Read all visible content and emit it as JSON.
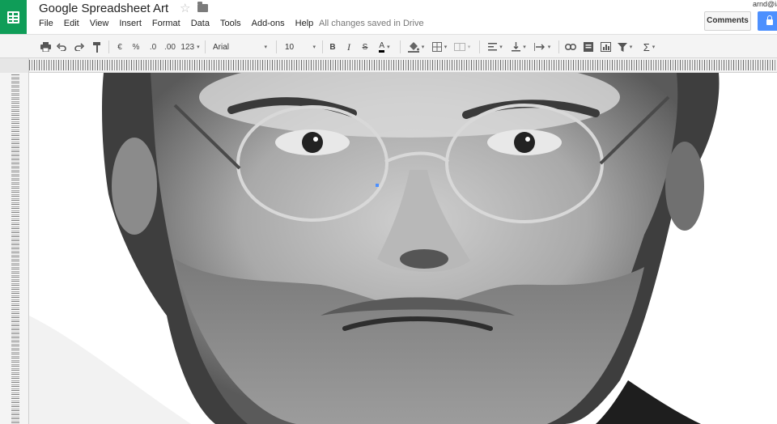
{
  "header": {
    "doc_title": "Google Spreadsheet Art",
    "menu": [
      "File",
      "Edit",
      "View",
      "Insert",
      "Format",
      "Data",
      "Tools",
      "Add-ons",
      "Help"
    ],
    "save_status": "All changes saved in Drive",
    "comments_label": "Comments",
    "user_email": "arnd@ia"
  },
  "toolbar": {
    "currency": "€",
    "percent": "%",
    "decrease_decimals": ".0",
    "increase_decimals": ".00",
    "more_formats": "123",
    "font_family": "Arial",
    "font_size": "10",
    "bold": "B",
    "italic": "I",
    "strikethrough": "S",
    "text_color": "A",
    "functions": "Σ"
  },
  "colors": {
    "sheets_green": "#0f9d58",
    "share_blue": "#4d90fe",
    "toolbar_bg": "#f4f4f4"
  },
  "icons": [
    "sheets-logo-icon",
    "star-icon",
    "folder-icon",
    "print-icon",
    "undo-icon",
    "redo-icon",
    "paint-format-icon",
    "fill-color-icon",
    "borders-icon",
    "merge-icon",
    "align-icon",
    "valign-icon",
    "wrap-icon",
    "link-icon",
    "comment-icon",
    "chart-icon",
    "filter-icon",
    "lock-icon"
  ]
}
